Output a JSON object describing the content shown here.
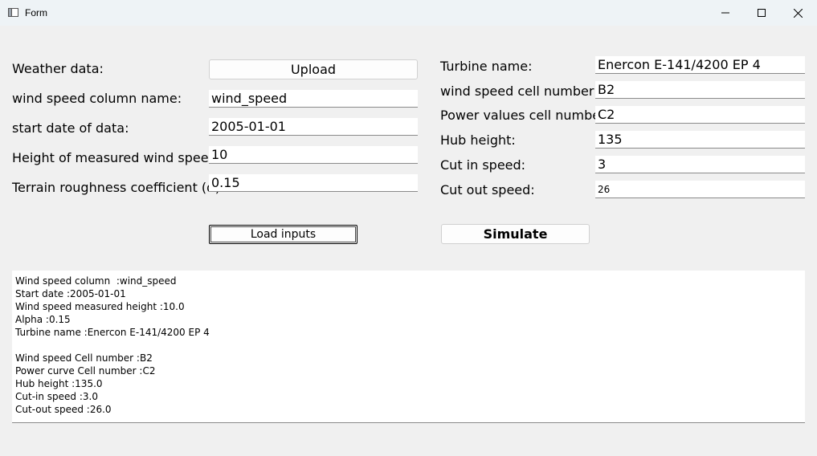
{
  "window": {
    "title": "Form"
  },
  "left_form": {
    "weather_label": "Weather data:",
    "upload_label": "Upload",
    "wind_col_label": "wind speed column name:",
    "wind_col_value": "wind_speed",
    "start_date_label": "start date of data:",
    "start_date_value": "2005-01-01",
    "height_label": "Height of measured wind speed:",
    "height_value": "10",
    "alpha_label": "Terrain roughness coefficient (α):",
    "alpha_value": "0.15",
    "load_label": "Load inputs"
  },
  "right_form": {
    "turbine_label": "Turbine name:",
    "turbine_value": "Enercon E-141/4200 EP 4",
    "wind_cell_label": "wind speed cell number:",
    "wind_cell_value": "B2",
    "power_cell_label": "Power values cell number:",
    "power_cell_value": "C2",
    "hub_label": "Hub height:",
    "hub_value": "135",
    "cut_in_label": "Cut in speed:",
    "cut_in_value": "3",
    "cut_out_label": "Cut out speed:",
    "cut_out_value": "26",
    "simulate_label": "Simulate"
  },
  "output": {
    "text": "Wind speed column  :wind_speed\nStart date :2005-01-01\nWind speed measured height :10.0\nAlpha :0.15\nTurbine name :Enercon E-141/4200 EP 4\n\nWind speed Cell number :B2\nPower curve Cell number :C2\nHub height :135.0\nCut-in speed :3.0\nCut-out speed :26.0"
  },
  "icons": {
    "app": "window-app-icon",
    "minimize": "minimize-icon",
    "maximize": "maximize-icon",
    "close": "close-icon"
  }
}
